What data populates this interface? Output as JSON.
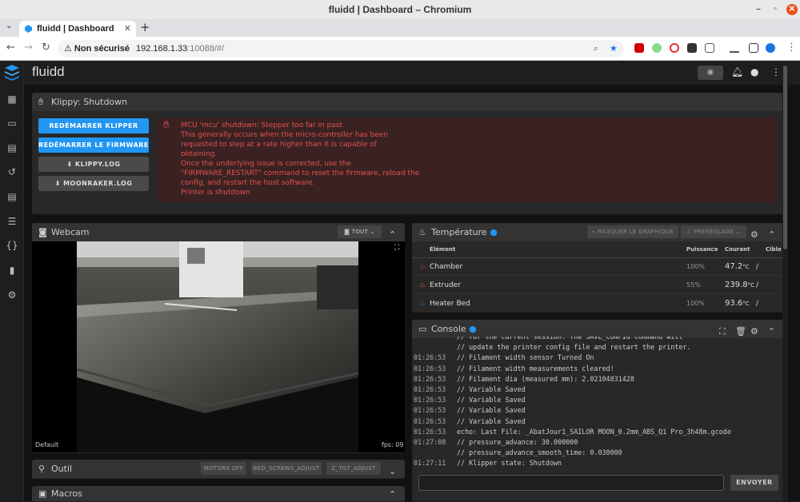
{
  "window": {
    "title": "fluidd | Dashboard – Chromium"
  },
  "tabs": [
    {
      "label": "fluidd | Dashboard"
    }
  ],
  "address": {
    "security": "Non sécurisé",
    "host": "192.168.1.33",
    "rest": ":10088/#/"
  },
  "app": {
    "brand": "fluidd"
  },
  "klippy": {
    "title": "Klippy: Shutdown",
    "buttons": [
      "REDÉMARRER KLIPPER",
      "REDÉMARRER LE FIRMWARE",
      "KLIPPY.LOG",
      "MOONRAKER.LOG"
    ],
    "message": [
      "MCU 'mcu' shutdown: Stepper too far in past",
      "This generally occurs when the micro-controller has been",
      "requested to step at a rate higher than it is capable of",
      "obtaining.",
      "Once the underlying issue is corrected, use the",
      "\"FIRMWARE_RESTART\" command to reset the firmware, reload the",
      "config, and restart the host software.",
      "Printer is shutdown"
    ]
  },
  "webcam": {
    "title": "Webcam",
    "select": "TOUT",
    "name": "Default",
    "fps": "fps: 09"
  },
  "outil": {
    "title": "Outil",
    "buttons": [
      "MOTORS OFF",
      "BED_SCREWS_ADJUST",
      "Z_TILT_ADJUST"
    ]
  },
  "macros": {
    "title": "Macros"
  },
  "temperature": {
    "title": "Température",
    "hide_graph": "MASQUER LE GRAPHIQUE",
    "preset": "PRÉRÉGLAGE",
    "headers": {
      "element": "Élément",
      "power": "Puissance",
      "current": "Courant",
      "target": "Cible"
    },
    "rows": [
      {
        "name": "Chamber",
        "power": "100%",
        "current": "47.2",
        "unit": "°C",
        "target": "/"
      },
      {
        "name": "Extruder",
        "power": "55%",
        "current": "239.8",
        "unit": "°C",
        "target": "/"
      },
      {
        "name": "Heater Bed",
        "power": "100%",
        "current": "93.6",
        "unit": "°C",
        "target": "/"
      }
    ],
    "colors": {
      "chamber": "#e53935",
      "extruder": "#ff7043",
      "bed": "#2196f3"
    }
  },
  "console": {
    "title": "Console",
    "send": "ENVOYER",
    "lines": [
      {
        "t": "",
        "m": "// for the current session. The SAVE_CONFIG command will"
      },
      {
        "t": "",
        "m": "// update the printer config file and restart the printer."
      },
      {
        "t": "01:26:53",
        "m": "// Filament width sensor Turned On"
      },
      {
        "t": "01:26:53",
        "m": "// Filament width measurements cleared!"
      },
      {
        "t": "01:26:53",
        "m": "// Filament dia (measured mm): 2.02104831428"
      },
      {
        "t": "01:26:53",
        "m": "// Variable Saved"
      },
      {
        "t": "01:26:53",
        "m": "// Variable Saved"
      },
      {
        "t": "01:26:53",
        "m": "// Variable Saved"
      },
      {
        "t": "01:26:53",
        "m": "// Variable Saved"
      },
      {
        "t": "01:26:53",
        "m": "echo: Last File: _AbatJour1_SAILOR MOON_0.2mm_ABS_Q1 Pro_3h48m.gcode"
      },
      {
        "t": "01:27:08",
        "m": "// pressure_advance: 30.000000"
      },
      {
        "t": "",
        "m": "// pressure_advance_smooth_time: 0.030000"
      },
      {
        "t": "01:27:11",
        "m": "// Klipper state: Shutdown"
      }
    ]
  }
}
